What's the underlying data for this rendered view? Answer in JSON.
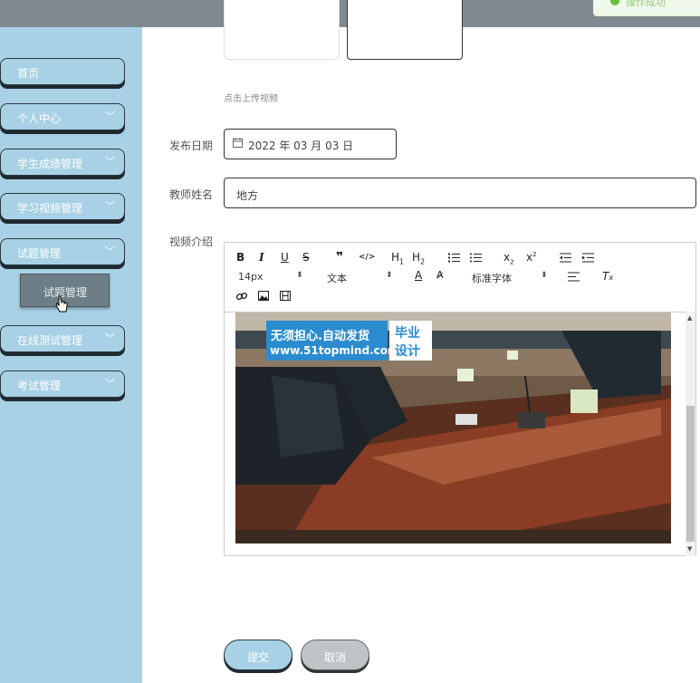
{
  "toast": {
    "text": "操作成功"
  },
  "sidebar": {
    "items": [
      {
        "label": "首页"
      },
      {
        "label": "个人中心"
      },
      {
        "label": "学生成绩管理"
      },
      {
        "label": "学习视频管理"
      },
      {
        "label": "试题管理"
      },
      {
        "label": "在线测试管理"
      },
      {
        "label": "考试管理"
      }
    ],
    "submenu": {
      "label": "试题管理"
    }
  },
  "form": {
    "upload_hint": "点击上传视频",
    "date_label": "发布日期",
    "date_value": "2022 年 03 月 03 日",
    "teacher_label": "教师姓名",
    "teacher_value": "地方",
    "intro_label": "视频介绍"
  },
  "editor": {
    "font_size": "14px",
    "paragraph": "文本",
    "font_family": "标准字体",
    "icons": [
      "bold-icon",
      "italic-icon",
      "underline-icon",
      "strikethrough-icon",
      "quote-icon",
      "code-icon",
      "h1-icon",
      "h2-icon",
      "ordered-list-icon",
      "bullet-list-icon",
      "subscript-icon",
      "superscript-icon",
      "outdent-icon",
      "indent-icon",
      "font-color-icon",
      "background-color-icon",
      "align-icon",
      "clear-format-icon",
      "link-icon",
      "image-icon",
      "video-icon"
    ]
  },
  "watermark": {
    "line1": "无须担心.自动发货",
    "line2": "www.51topmind.com",
    "tag1": "毕业",
    "tag2": "设计"
  },
  "buttons": {
    "submit": "提交",
    "cancel": "取消"
  },
  "colors": {
    "sidebar_bg": "#a8d1e6",
    "topbar": "#7f8a90",
    "cancel_bg": "#bfc4c6",
    "watermark_blue": "#2a8ccf"
  }
}
